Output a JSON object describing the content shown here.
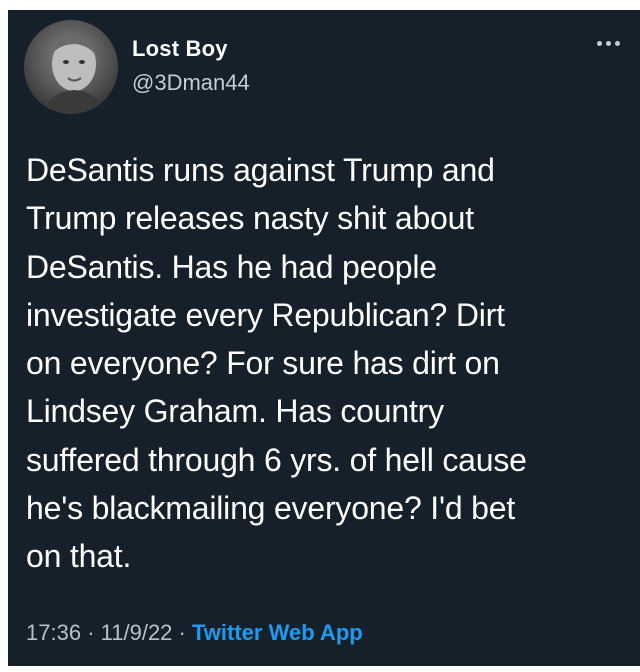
{
  "author": {
    "name": "Lost Boy",
    "handle": "@3Dman44",
    "avatar_icon": "profile-photo-icon"
  },
  "more_icon": "more-horizontal-icon",
  "tweet": {
    "lines": [
      "DeSantis runs against Trump and",
      "Trump releases nasty shit about",
      "DeSantis. Has he had people",
      "investigate every Republican? Dirt",
      "on everyone? For sure has dirt on",
      "Lindsey Graham. Has country",
      "suffered through 6 yrs. of hell cause",
      "he's blackmailing everyone? I'd bet",
      "on that."
    ]
  },
  "meta": {
    "time": "17:36",
    "separator": "·",
    "date": "11/9/22",
    "source": "Twitter Web App"
  },
  "colors": {
    "background": "#15202b",
    "text": "#ffffff",
    "secondary": "#b8c1ca",
    "link": "#1d9bf0"
  }
}
